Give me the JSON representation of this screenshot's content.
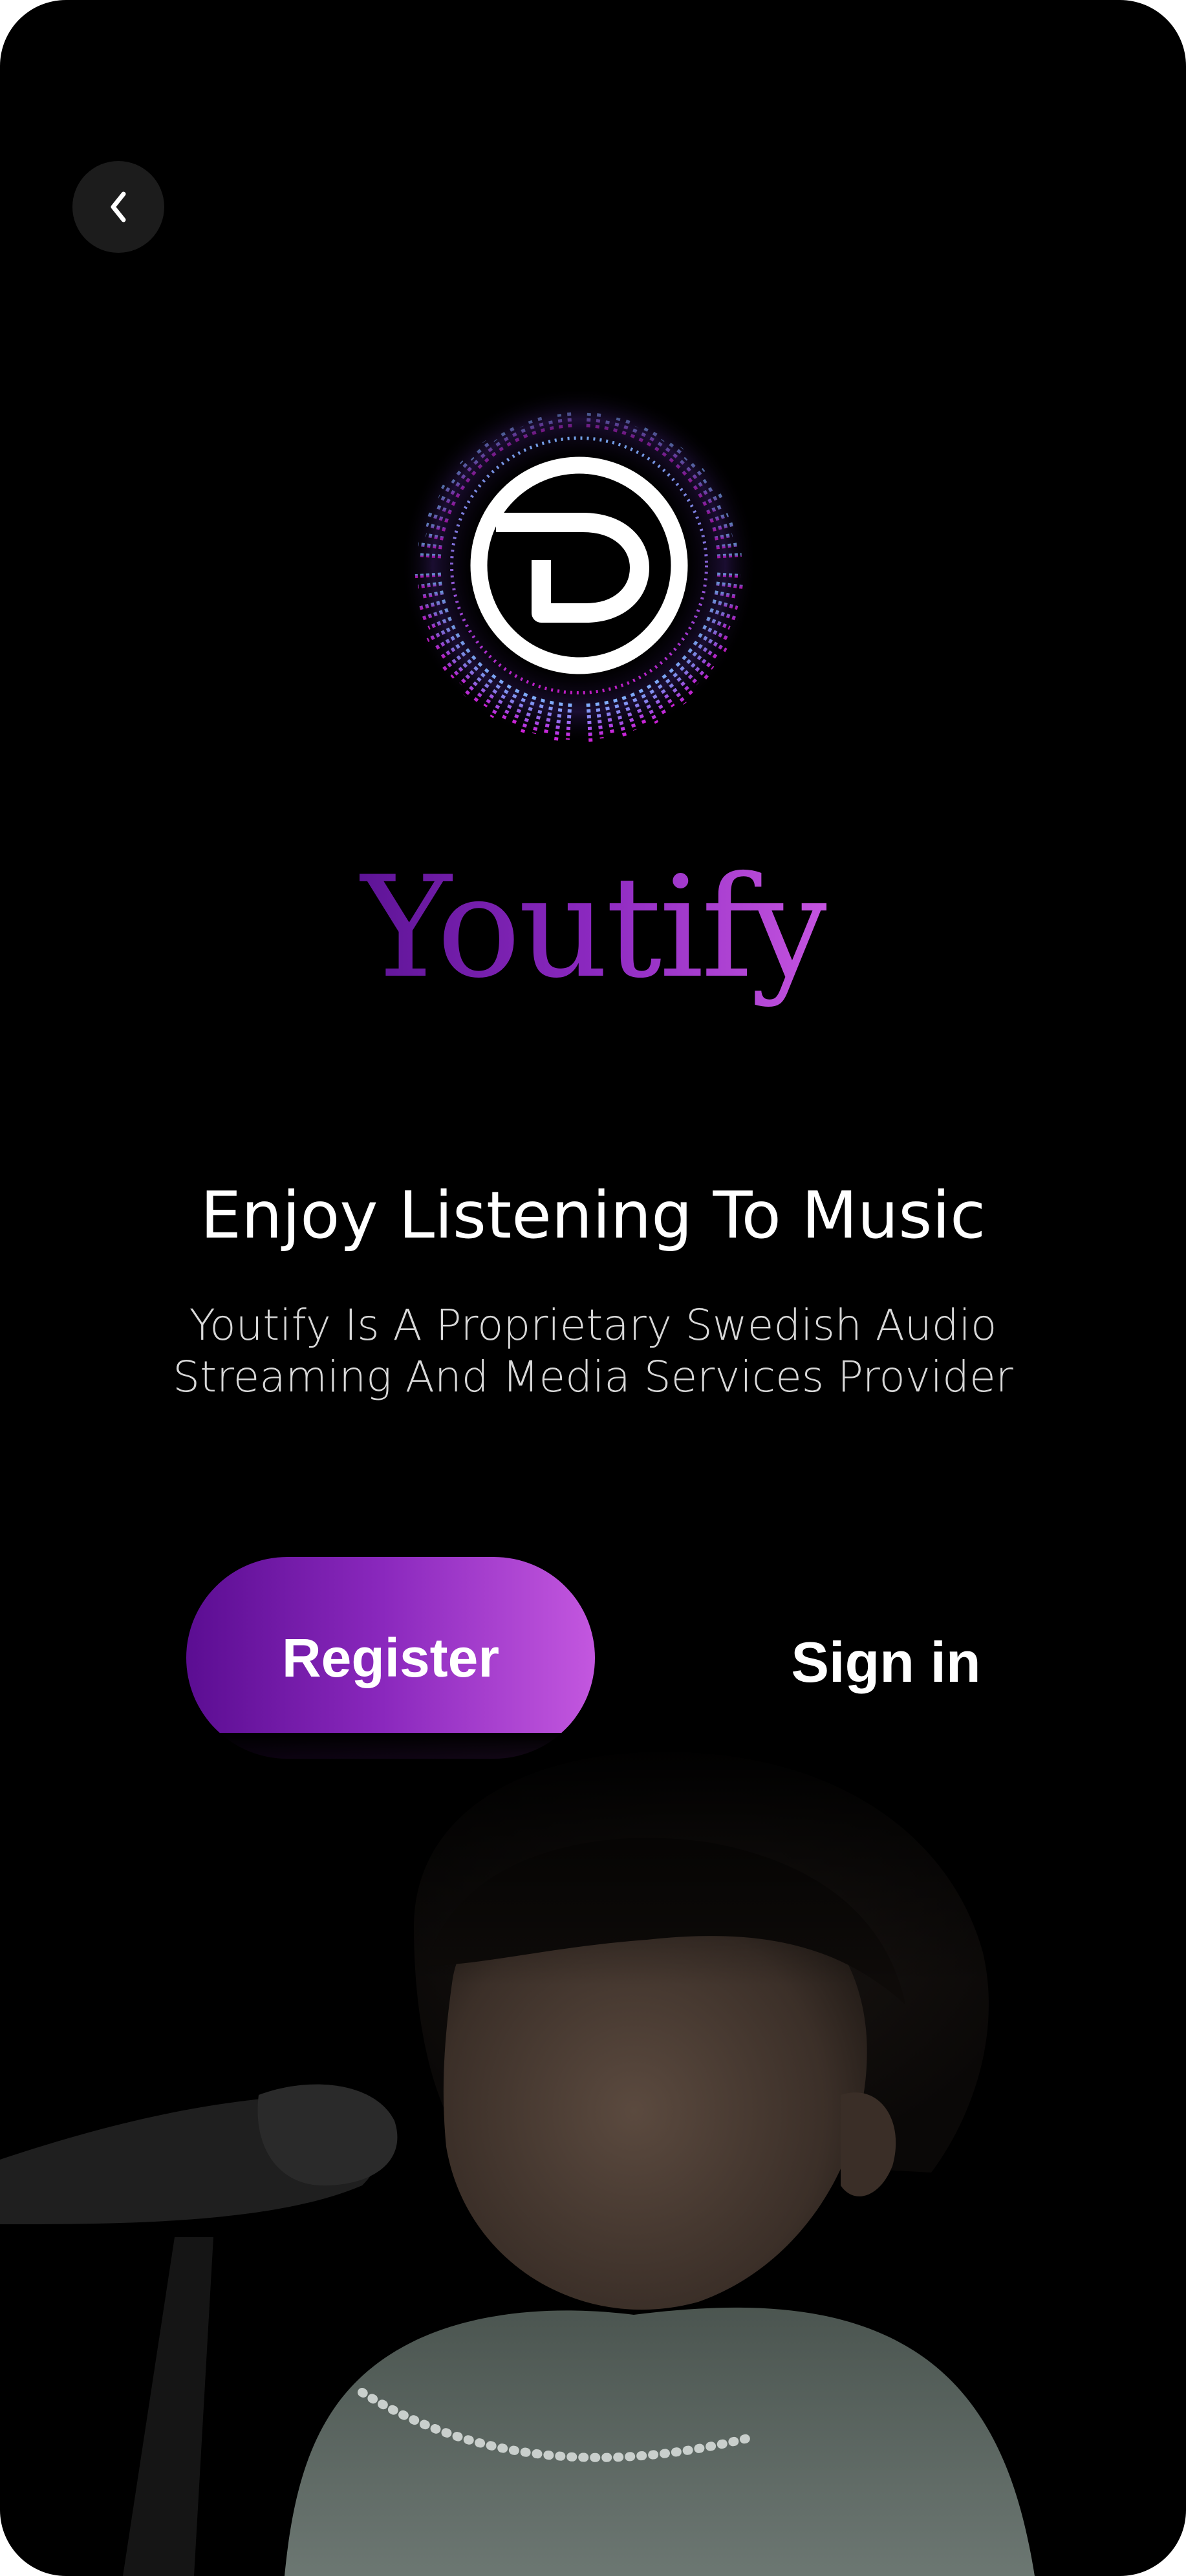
{
  "screen": {
    "background": "#000000"
  },
  "header": {
    "back_icon": "chevron-left-icon"
  },
  "brand": {
    "name": "Youtify",
    "logo_icon": "youtify-disc-logo",
    "gradient_start": "#5e1497",
    "gradient_end": "#c554e0"
  },
  "intro": {
    "headline": "Enjoy Listening To Music",
    "subtitle_line1": "Youtify Is A Proprietary Swedish Audio",
    "subtitle_line2": "Streaming And Media Services Provider"
  },
  "actions": {
    "register_label": "Register",
    "signin_label": "Sign in",
    "accent_start": "#5b0d92",
    "accent_end": "#c357df"
  },
  "hero": {
    "image": "singer-with-microphone-photo"
  }
}
